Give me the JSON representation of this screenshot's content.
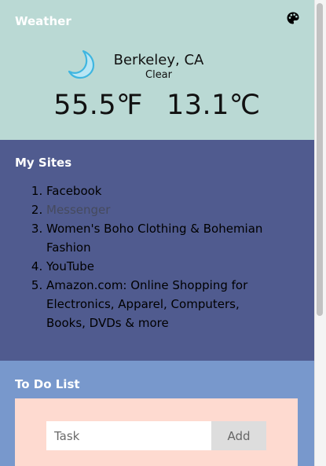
{
  "weather": {
    "title": "Weather",
    "location": "Berkeley, CA",
    "condition": "Clear",
    "temp_f": "55.5℉",
    "temp_c": "13.1℃",
    "icon": "moon-icon",
    "settings_icon": "palette-icon"
  },
  "sites": {
    "title": "My Sites",
    "items": [
      {
        "label": "Facebook",
        "visited": false
      },
      {
        "label": "Messenger",
        "visited": true
      },
      {
        "label": "Women's Boho Clothing & Bohemian Fashion",
        "visited": false
      },
      {
        "label": "YouTube",
        "visited": false
      },
      {
        "label": "Amazon.com: Online Shopping for Electronics, Apparel, Computers, Books, DVDs & more",
        "visited": false
      }
    ]
  },
  "todo": {
    "title": "To Do List",
    "input_placeholder": "Task",
    "input_value": "",
    "add_label": "Add"
  },
  "colors": {
    "weather_bg": "#bad9d4",
    "sites_bg": "#505b8f",
    "todo_bg": "#7898cc",
    "todo_card_bg": "#fedad0",
    "moon": "#5ec5e8"
  }
}
